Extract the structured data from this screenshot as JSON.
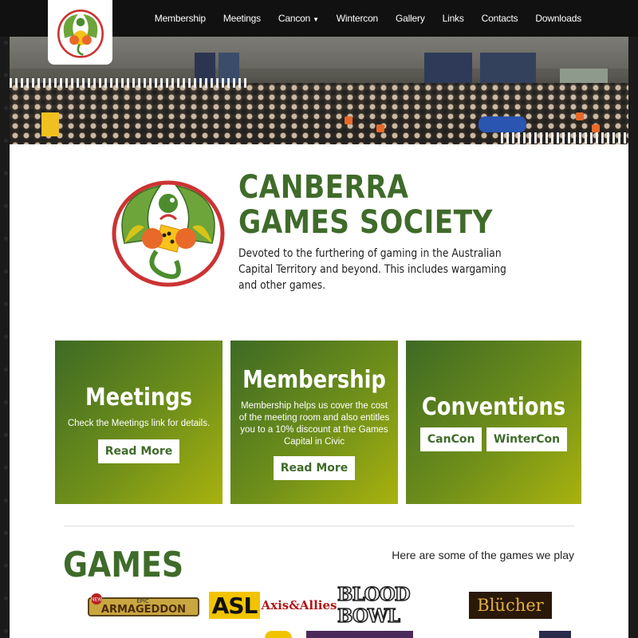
{
  "nav": {
    "items": [
      {
        "label": "Membership"
      },
      {
        "label": "Meetings"
      },
      {
        "label": "Cancon",
        "has_dropdown": true
      },
      {
        "label": "Wintercon"
      },
      {
        "label": "Gallery"
      },
      {
        "label": "Links"
      },
      {
        "label": "Contacts"
      },
      {
        "label": "Downloads"
      }
    ],
    "logo_icon": "dragon-logo-icon"
  },
  "brand": {
    "title_line1": "CANBERRA",
    "title_line2": "GAMES SOCIETY",
    "tagline": "Devoted to the furthering of gaming in the Australian Capital Territory and beyond. This includes wargaming and other games."
  },
  "cards": {
    "meetings": {
      "title": "Meetings",
      "text": "Check the Meetings link for details.",
      "button": "Read More"
    },
    "membership": {
      "title": "Membership",
      "text": "Membership helps us cover the cost of the meeting room and also entitles you to a 10% discount at the Games Capital in Civic",
      "button": "Read More"
    },
    "conventions": {
      "title": "Conventions",
      "button1": "CanCon",
      "button2": "WinterCon"
    }
  },
  "games": {
    "title": "GAMES",
    "subtitle": "Here are some of the games we play",
    "logos": [
      "ARMAGEDDON",
      "ASL",
      "Axis&Allies",
      "BLOOD BOWL",
      "Blücher"
    ],
    "logo_badge": "NEW",
    "logo_epic": "EPIC"
  },
  "colors": {
    "brand_green": "#3f6b2a",
    "card_gradient_start": "#3e6a24",
    "card_gradient_end": "#a8b20e"
  }
}
